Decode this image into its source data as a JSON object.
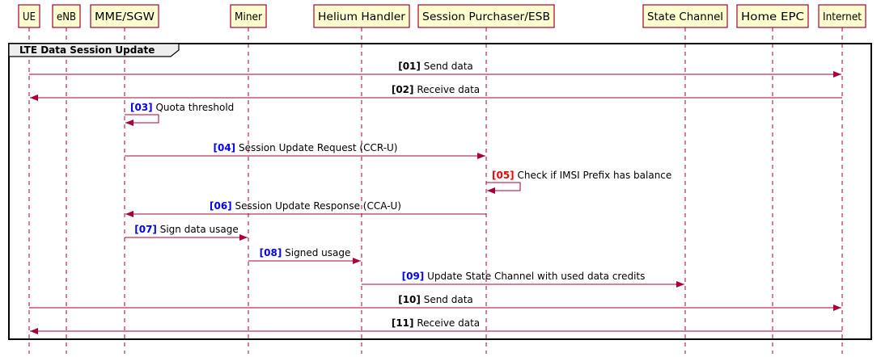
{
  "participants": [
    {
      "id": "ue",
      "label": "UE"
    },
    {
      "id": "enb",
      "label": "eNB"
    },
    {
      "id": "mme",
      "label": "MME/SGW"
    },
    {
      "id": "miner",
      "label": "Miner"
    },
    {
      "id": "helium",
      "label": "Helium Handler"
    },
    {
      "id": "esb",
      "label": "Session Purchaser/ESB"
    },
    {
      "id": "statechannel",
      "label": "State Channel"
    },
    {
      "id": "homeepc",
      "label": "Home EPC"
    },
    {
      "id": "internet",
      "label": "Internet"
    }
  ],
  "frame": {
    "title": "LTE Data Session Update"
  },
  "messages": [
    {
      "num": "[01]",
      "text": "Send data",
      "from": "ue",
      "to": "internet",
      "num_color": "#000000"
    },
    {
      "num": "[02]",
      "text": "Receive data",
      "from": "internet",
      "to": "ue",
      "num_color": "#000000"
    },
    {
      "num": "[03]",
      "text": "Quota  threshold",
      "from": "mme",
      "to": "mme",
      "num_color": "#0000FF"
    },
    {
      "num": "[04]",
      "text": "Session Update Request (CCR-U)",
      "from": "mme",
      "to": "esb",
      "num_color": "#0000FF"
    },
    {
      "num": "[05]",
      "text": "Check if IMSI Prefix has balance",
      "from": "esb",
      "to": "esb",
      "num_color": "#FF0000"
    },
    {
      "num": "[06]",
      "text": "Session Update Response (CCA-U)",
      "from": "esb",
      "to": "mme",
      "num_color": "#0000FF"
    },
    {
      "num": "[07]",
      "text": "Sign data usage",
      "from": "mme",
      "to": "miner",
      "num_color": "#0000FF"
    },
    {
      "num": "[08]",
      "text": "Signed usage",
      "from": "miner",
      "to": "helium",
      "num_color": "#0000FF"
    },
    {
      "num": "[09]",
      "text": "Update State Channel with used data credits",
      "from": "helium",
      "to": "statechannel",
      "num_color": "#0000FF"
    },
    {
      "num": "[10]",
      "text": "Send data",
      "from": "ue",
      "to": "internet",
      "num_color": "#000000"
    },
    {
      "num": "[11]",
      "text": "Receive data",
      "from": "internet",
      "to": "ue",
      "num_color": "#000000"
    }
  ],
  "colors": {
    "line": "#A80036",
    "participant_fill": "#FEFECE",
    "frame_tab": "#EEEEEE"
  }
}
